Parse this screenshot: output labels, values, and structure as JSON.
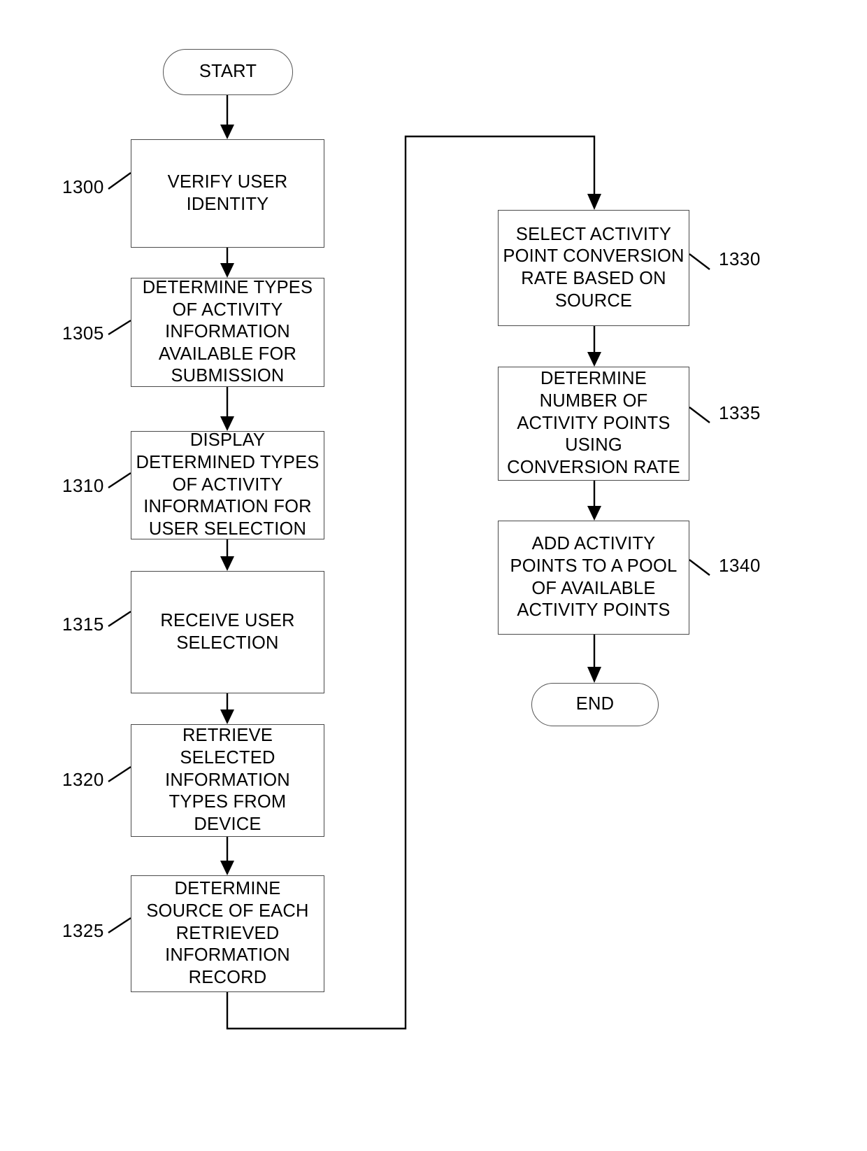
{
  "diagram": {
    "type": "flowchart",
    "orientation": "two-column-vertical",
    "start_label": "START",
    "end_label": "END",
    "left_column": [
      {
        "ref": "1300",
        "text": "VERIFY USER IDENTITY"
      },
      {
        "ref": "1305",
        "text": "DETERMINE TYPES OF ACTIVITY INFORMATION AVAILABLE FOR SUBMISSION"
      },
      {
        "ref": "1310",
        "text": "DISPLAY DETERMINED TYPES OF ACTIVITY INFORMATION FOR USER SELECTION"
      },
      {
        "ref": "1315",
        "text": "RECEIVE USER SELECTION"
      },
      {
        "ref": "1320",
        "text": "RETRIEVE SELECTED INFORMATION TYPES FROM DEVICE"
      },
      {
        "ref": "1325",
        "text": "DETERMINE SOURCE OF EACH RETRIEVED INFORMATION RECORD"
      }
    ],
    "right_column": [
      {
        "ref": "1330",
        "text": "SELECT ACTIVITY POINT CONVERSION RATE BASED ON SOURCE"
      },
      {
        "ref": "1335",
        "text": "DETERMINE NUMBER OF ACTIVITY POINTS USING CONVERSION RATE"
      },
      {
        "ref": "1340",
        "text": "ADD ACTIVITY POINTS TO A POOL OF AVAILABLE ACTIVITY POINTS"
      }
    ],
    "colors": {
      "line": "#000000",
      "box_border": "#4a4a4a",
      "background": "#ffffff",
      "text": "#000000"
    }
  }
}
